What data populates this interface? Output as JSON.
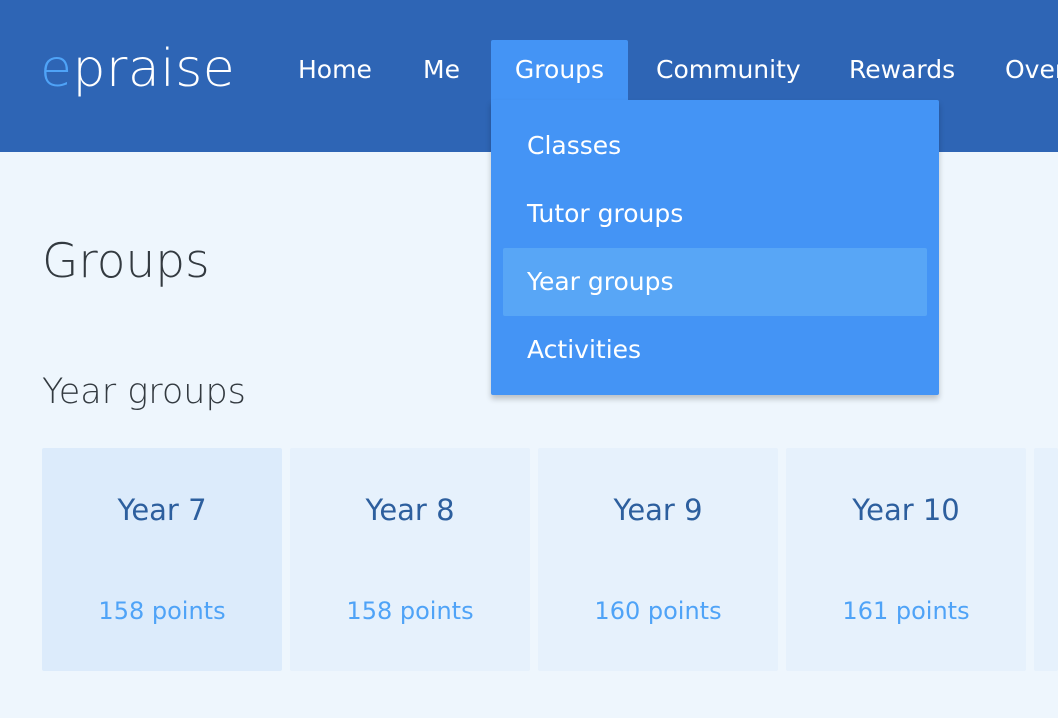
{
  "logo": {
    "initial": "e",
    "rest": "praise"
  },
  "nav": {
    "items": [
      {
        "label": "Home"
      },
      {
        "label": "Me"
      },
      {
        "label": "Groups",
        "active": true
      },
      {
        "label": "Community"
      },
      {
        "label": "Rewards"
      },
      {
        "label": "Over"
      }
    ]
  },
  "dropdown": {
    "items": [
      {
        "label": "Classes"
      },
      {
        "label": "Tutor groups"
      },
      {
        "label": "Year groups",
        "highlighted": true
      },
      {
        "label": "Activities"
      }
    ]
  },
  "page": {
    "title": "Groups",
    "section_title": "Year groups"
  },
  "cards": [
    {
      "name": "Year 7",
      "points": "158 points"
    },
    {
      "name": "Year 8",
      "points": "158 points"
    },
    {
      "name": "Year 9",
      "points": "160 points"
    },
    {
      "name": "Year 10",
      "points": "161 points"
    }
  ],
  "colors": {
    "header": "#2e65b5",
    "accent": "#4494f5",
    "accent_highlight": "#58a6f6",
    "logo_accent": "#4fa3f7",
    "page_background": "#eef6fd",
    "card_background": "#e6f1fc",
    "card_title": "#2d5f9e",
    "card_points": "#4fa3f7"
  }
}
